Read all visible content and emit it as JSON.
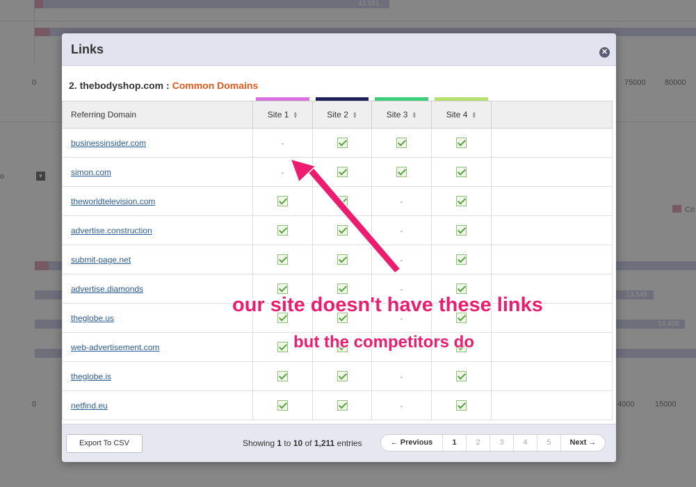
{
  "background": {
    "top_value": "43,551",
    "axis1_ticks": [
      "0",
      "75000",
      "80000"
    ],
    "legend_label": "Co",
    "values": [
      "13,549",
      "14,400"
    ],
    "axis2_ticks": [
      "0",
      "4000",
      "15000"
    ],
    "box_glyph": "▾",
    "side_text": "o"
  },
  "modal": {
    "title": "Links",
    "close_glyph": "✕",
    "subtitle_prefix": "2. thebodyshop.com :",
    "subtitle_highlight": "Common Domains",
    "columns": {
      "domain": "Referring Domain",
      "sites": [
        {
          "label": "Site 1",
          "color": "#d970e0"
        },
        {
          "label": "Site 2",
          "color": "#1f1f5a"
        },
        {
          "label": "Site 3",
          "color": "#3ecb7a"
        },
        {
          "label": "Site 4",
          "color": "#b8e070"
        }
      ]
    },
    "rows": [
      {
        "domain": "businessinsider.com",
        "sites": [
          false,
          true,
          true,
          true
        ]
      },
      {
        "domain": "simon.com",
        "sites": [
          false,
          true,
          true,
          true
        ]
      },
      {
        "domain": "theworldtelevision.com",
        "sites": [
          true,
          true,
          false,
          true
        ]
      },
      {
        "domain": "advertise.construction",
        "sites": [
          true,
          true,
          false,
          true
        ]
      },
      {
        "domain": "submit-page.net",
        "sites": [
          true,
          true,
          false,
          true
        ]
      },
      {
        "domain": "advertise.diamonds",
        "sites": [
          true,
          true,
          false,
          true
        ]
      },
      {
        "domain": "theglobe.us",
        "sites": [
          true,
          true,
          false,
          true
        ]
      },
      {
        "domain": "web-advertisement.com",
        "sites": [
          true,
          true,
          false,
          true
        ]
      },
      {
        "domain": "theglobe.is",
        "sites": [
          true,
          true,
          false,
          true
        ]
      },
      {
        "domain": "netfind.eu",
        "sites": [
          true,
          true,
          false,
          true
        ]
      }
    ],
    "empty_mark": "-",
    "footer": {
      "export_label": "Export To CSV",
      "entries_prefix": "Showing",
      "entries_from": "1",
      "entries_to_word": "to",
      "entries_to": "10",
      "entries_of_word": "of",
      "entries_total": "1,211",
      "entries_suffix": "entries",
      "previous_label": "← Previous",
      "pages": [
        "1",
        "2",
        "3",
        "4",
        "5"
      ],
      "active_page": "1",
      "next_label": "Next →"
    }
  },
  "annotation": {
    "main_text": "our site doesn't have these links",
    "sub_text": "but the competitors do",
    "color": "#ec1c6e"
  }
}
